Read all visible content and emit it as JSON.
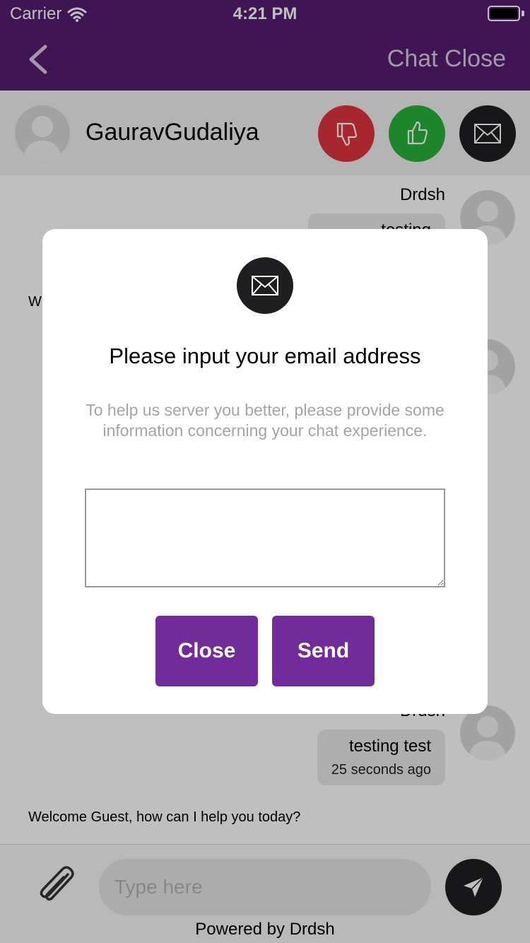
{
  "status_bar": {
    "carrier": "Carrier",
    "time": "4:21 PM"
  },
  "nav": {
    "title": "Chat Close",
    "back_icon": "chevron-left-icon"
  },
  "agent": {
    "name": "GauravGudaliya",
    "actions": [
      "thumbs-down-icon",
      "thumbs-up-icon",
      "envelope-icon"
    ]
  },
  "chat": {
    "messages": [
      {
        "sender": "Drdsh",
        "text": "testing"
      },
      {
        "sender": "Drdsh",
        "text": "testing test",
        "time": "25 seconds ago"
      }
    ],
    "partial_left_text": "W",
    "welcome_text": "Welcome Guest, how can I help you today?"
  },
  "input_bar": {
    "placeholder": "Type here",
    "powered_by": "Powered by Drdsh"
  },
  "modal": {
    "title": "Please input your email address",
    "description": "To help us server you better, please provide some information concerning your chat experience.",
    "email_value": "",
    "close_label": "Close",
    "send_label": "Send"
  },
  "colors": {
    "brand": "#561d70",
    "button": "#722b9b",
    "dislike": "#e0343f",
    "like": "#27b33a",
    "dark": "#1f1e21"
  }
}
